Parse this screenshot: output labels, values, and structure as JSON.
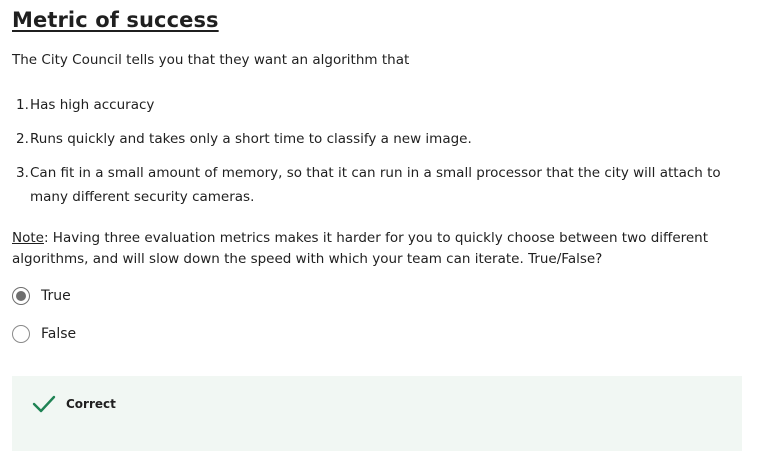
{
  "title": "Metric of success",
  "intro": "The City Council tells you that they want an algorithm that",
  "requirements": [
    {
      "num": "1.",
      "text": "Has high accuracy"
    },
    {
      "num": "2.",
      "text": "Runs quickly and takes only a short time to classify a new image."
    },
    {
      "num": "3.",
      "text": "Can fit in a small amount of memory, so that it can run in a small processor that the city will attach to many different security cameras."
    }
  ],
  "question": {
    "note_label": "Note",
    "text": ": Having three evaluation metrics makes it harder for you to quickly choose between two different algorithms, and will slow down the speed with which your team can iterate. True/False?"
  },
  "options": [
    {
      "label": "True",
      "selected": true
    },
    {
      "label": "False",
      "selected": false
    }
  ],
  "feedback": {
    "status": "Correct",
    "icon": "checkmark-icon",
    "color": "#1f8354"
  }
}
